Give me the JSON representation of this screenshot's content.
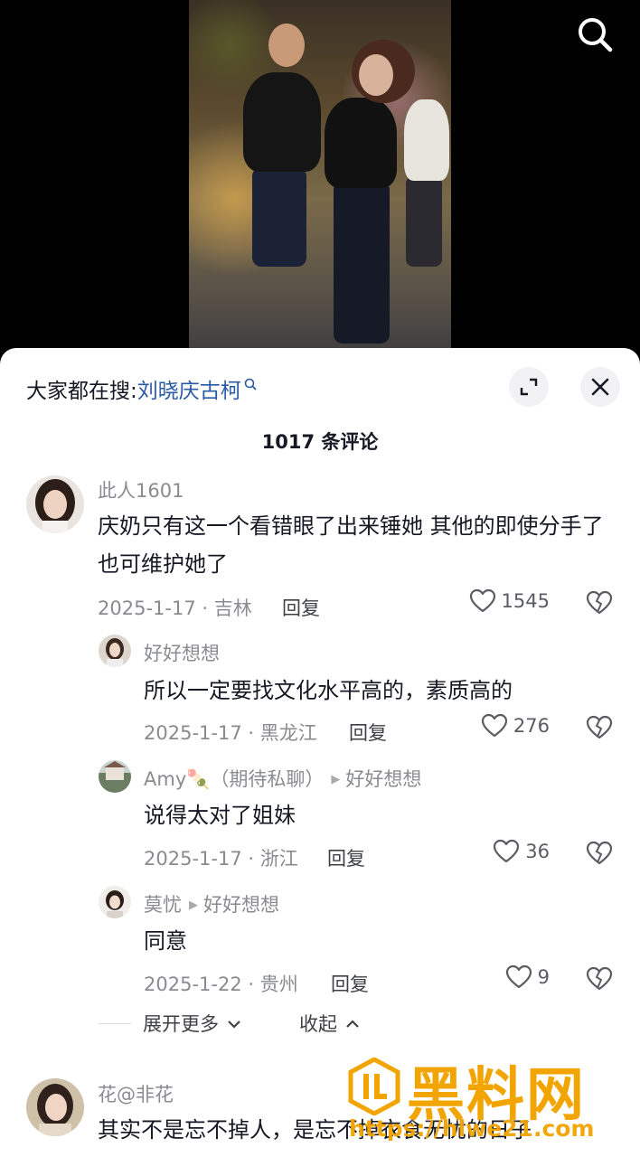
{
  "video": {
    "search_icon": "search-icon"
  },
  "sheet": {
    "hot_search_prefix": "大家都在搜:",
    "hot_search_keyword": "刘晓庆古柯",
    "comment_count_title": "1017 条评论"
  },
  "comments": [
    {
      "username": "此人1601",
      "text": "庆奶只有这一个看错眼了出来锤她 其他的即使分手了也可维护她了",
      "date_location": "2025-1-17 · 吉林",
      "reply_label": "回复",
      "likes": "1545"
    },
    {
      "username": "好好想想",
      "text": "所以一定要找文化水平高的，素质高的",
      "date_location": "2025-1-17 · 黑龙江",
      "reply_label": "回复",
      "likes": "276"
    },
    {
      "username": "Amy🍡（期待私聊）",
      "reply_to": "好好想想",
      "text": "说得太对了姐妹",
      "date_location": "2025-1-17 · 浙江",
      "reply_label": "回复",
      "likes": "36"
    },
    {
      "username": "莫忧",
      "reply_to": "好好想想",
      "text": "同意",
      "date_location": "2025-1-22 · 贵州",
      "reply_label": "回复",
      "likes": "9"
    },
    {
      "username": "花@非花",
      "text": "其实不是忘不掉人，是忘不掉衣食无忧的日子"
    }
  ],
  "thread_actions": {
    "expand_more": "展开更多",
    "collapse": "收起"
  },
  "watermark": {
    "text": "黑料网",
    "url": "https://hlwe21.com"
  },
  "colors": {
    "keyword_blue": "#2a5aa6",
    "watermark_orange": "#f2a400"
  }
}
